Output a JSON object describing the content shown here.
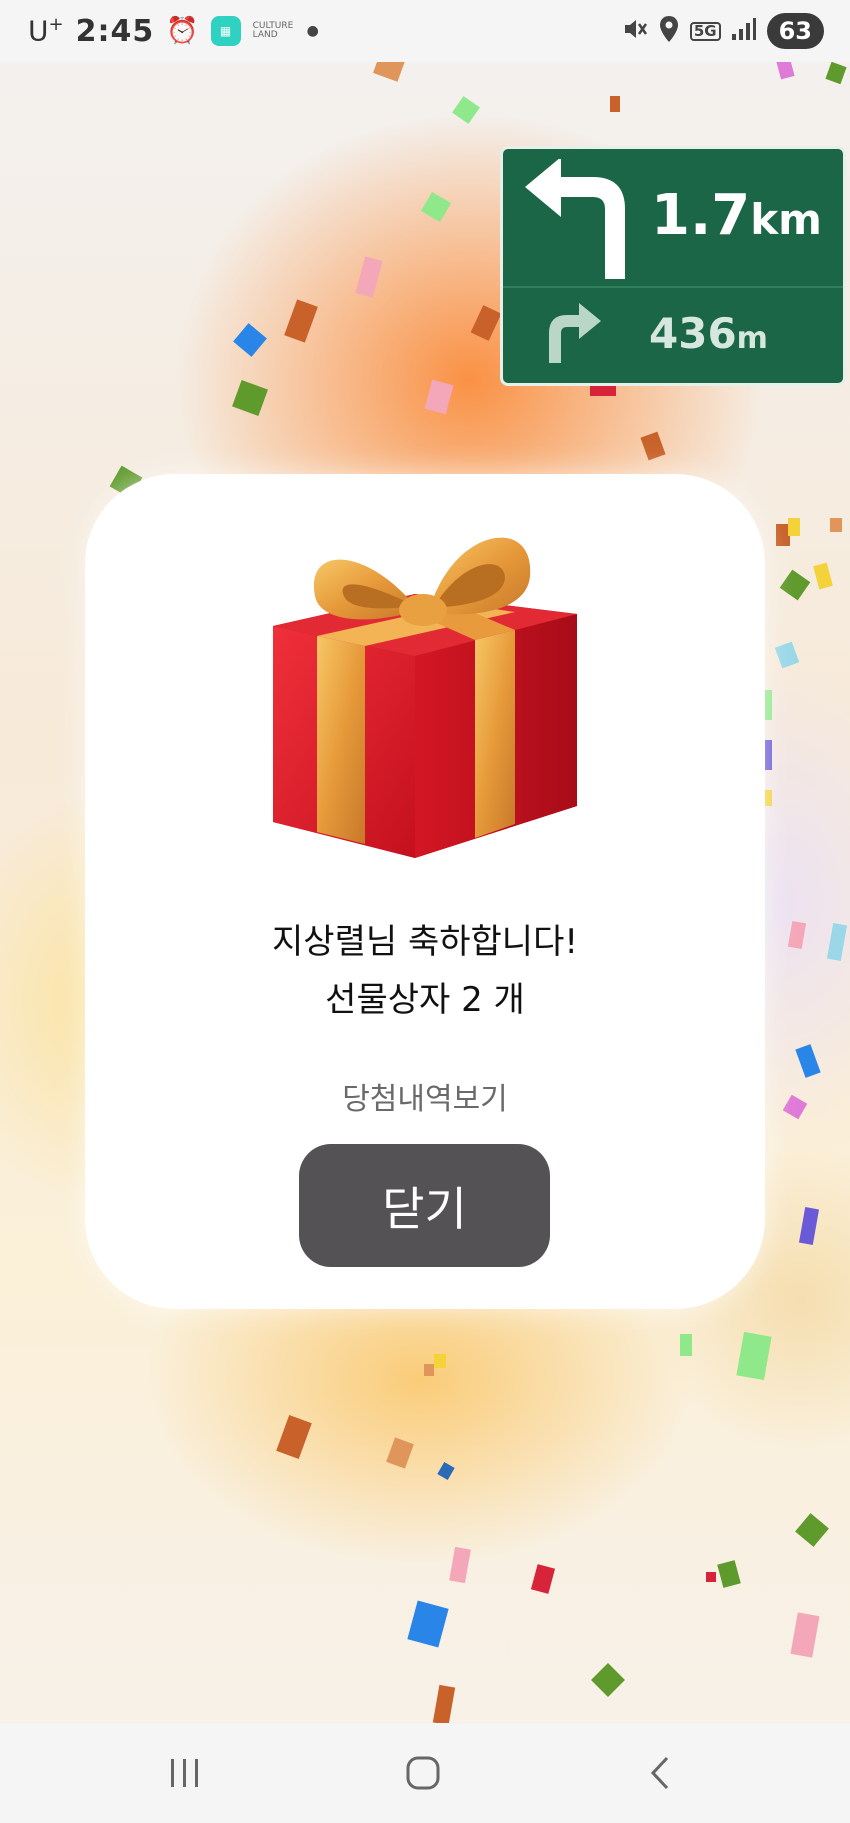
{
  "status_bar": {
    "carrier": "U",
    "carrier_sup": "+",
    "time": "2:45",
    "app_label_top": "CULTURE",
    "app_label_bottom": "LAND",
    "network": "5G",
    "battery": "63"
  },
  "nav_sign": {
    "primary_distance": "1.7",
    "primary_unit": "km",
    "secondary_distance": "436",
    "secondary_unit": "m",
    "color": "#1b6647"
  },
  "dialog": {
    "message_line1": "지상렬님 축하합니다!",
    "message_line2": "선물상자 2 개",
    "history_link": "당첨내역보기",
    "close_button": "닫기",
    "button_color": "#545254"
  },
  "system_nav": {
    "recents_icon": "recents-icon",
    "home_icon": "home-icon",
    "back_icon": "back-icon"
  }
}
